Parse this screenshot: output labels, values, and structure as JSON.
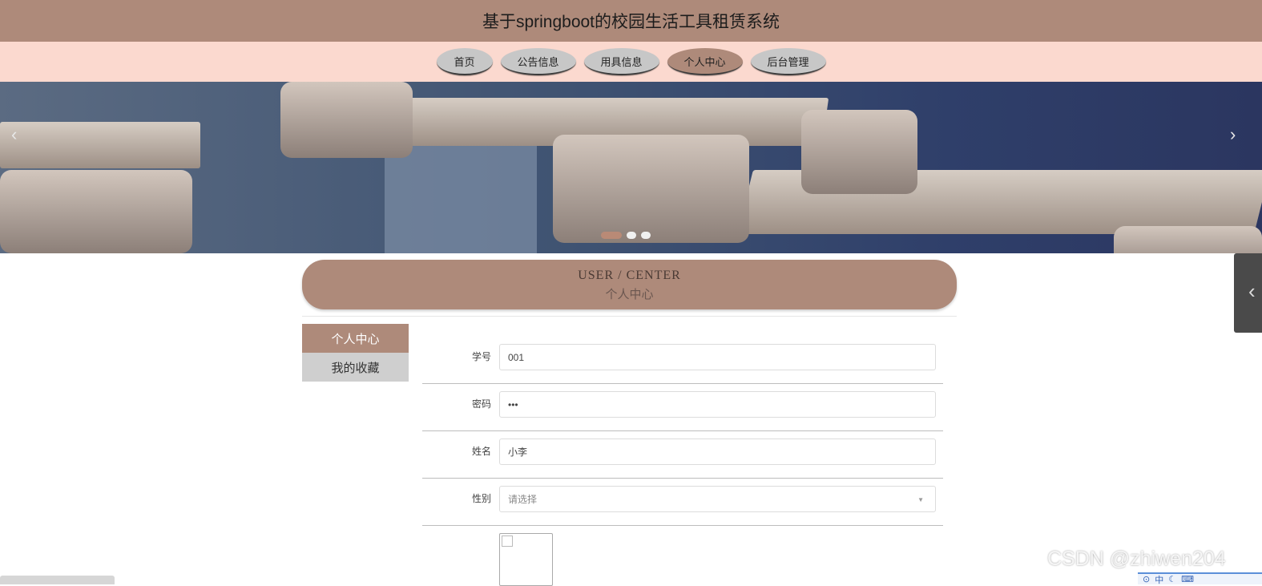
{
  "header": {
    "title": "基于springboot的校园生活工具租赁系统"
  },
  "nav": {
    "items": [
      {
        "label": "首页"
      },
      {
        "label": "公告信息"
      },
      {
        "label": "用具信息"
      },
      {
        "label": "个人中心"
      },
      {
        "label": "后台管理"
      }
    ],
    "active": "个人中心"
  },
  "banner": {
    "prev_icon": "chevron-left-icon",
    "next_icon": "chevron-right-icon",
    "slide_count": 3,
    "active_slide": 1
  },
  "user_center": {
    "title_en": "USER / CENTER",
    "title_cn": "个人中心"
  },
  "side_menu": {
    "items": [
      {
        "label": "个人中心"
      },
      {
        "label": "我的收藏"
      }
    ],
    "active": "个人中心"
  },
  "form": {
    "student_id": {
      "label": "学号",
      "value": "001"
    },
    "password": {
      "label": "密码",
      "value": "•••"
    },
    "name": {
      "label": "姓名",
      "value": "小李"
    },
    "gender": {
      "label": "性别",
      "placeholder": "请选择"
    }
  },
  "watermark": "CSDN @zhiwen204",
  "colors": {
    "accent": "#ae8a7a",
    "nav_bg": "#fbd9cf",
    "inactive": "#cfcfcf"
  }
}
